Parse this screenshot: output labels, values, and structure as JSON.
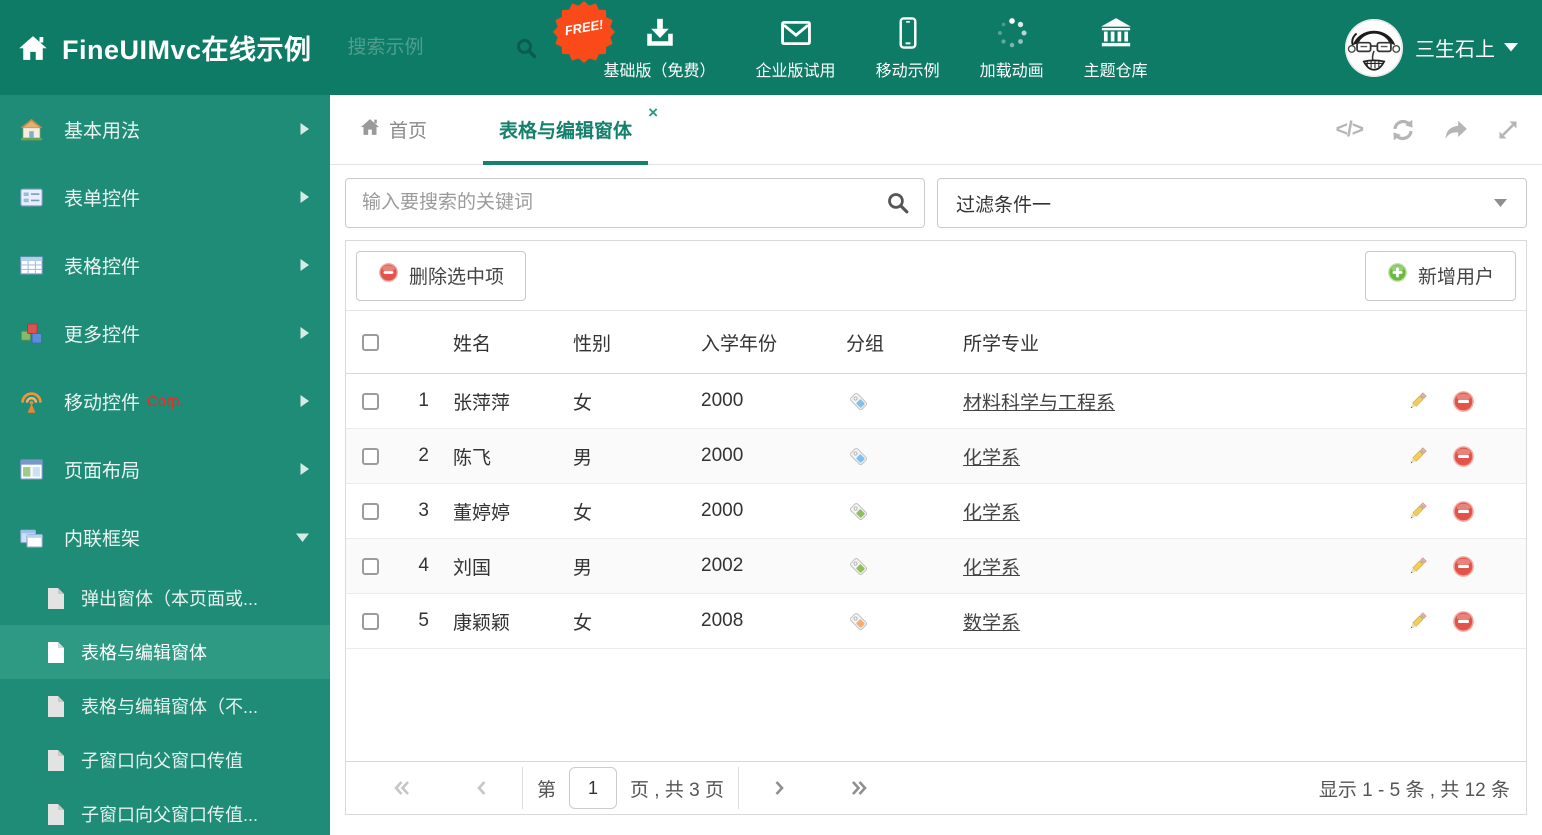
{
  "theme": {
    "header_bg": "#0e7b67",
    "sidebar_bg": "#1f8c77",
    "sidebar_active_bg": "#2f9a84",
    "accent_teal": "#15806b",
    "free_badge_bg": "#fb4a1a",
    "corp_badge_red": "#ff2222",
    "delete_red": "#e0544a",
    "add_green": "#6cb93f",
    "pencil_yellow": "#f2cd5e",
    "tag_blue": "#7ec1f0",
    "tag_green": "#8fbf5a",
    "tag_orange": "#f5ae6b"
  },
  "icons": {
    "code": "</>",
    "close": "×"
  },
  "header": {
    "title": "FineUIMvc在线示例",
    "search_placeholder": "搜索示例",
    "nav": [
      {
        "label": "基础版（免费）",
        "badge": "FREE!",
        "icon": "download-icon"
      },
      {
        "label": "企业版试用",
        "icon": "envelope-icon"
      },
      {
        "label": "移动示例",
        "icon": "mobile-icon"
      },
      {
        "label": "加载动画",
        "icon": "spinner-icon"
      },
      {
        "label": "主题仓库",
        "icon": "bank-icon"
      }
    ],
    "user_name": "三生石上"
  },
  "sidebar": {
    "items": [
      {
        "label": "基本用法",
        "icon": "house-icon"
      },
      {
        "label": "表单控件",
        "icon": "form-icon"
      },
      {
        "label": "表格控件",
        "icon": "table-icon"
      },
      {
        "label": "更多控件",
        "icon": "cubes-icon"
      },
      {
        "label": "移动控件",
        "badge": "Corp.",
        "icon": "antenna-icon"
      },
      {
        "label": "页面布局",
        "icon": "layout-icon"
      },
      {
        "label": "内联框架",
        "icon": "frames-icon",
        "expanded": true
      }
    ],
    "subitems": [
      {
        "label": "弹出窗体（本页面或..."
      },
      {
        "label": "表格与编辑窗体",
        "active": true
      },
      {
        "label": "表格与编辑窗体（不..."
      },
      {
        "label": "子窗口向父窗口传值"
      },
      {
        "label": "子窗口向父窗口传值..."
      }
    ]
  },
  "tabs": {
    "home": "首页",
    "active": "表格与编辑窗体"
  },
  "filterbar": {
    "search_placeholder": "输入要搜索的关键词",
    "filter_selected": "过滤条件一"
  },
  "toolbar": {
    "delete_label": "删除选中项",
    "add_label": "新增用户"
  },
  "table": {
    "columns": {
      "name": "姓名",
      "gender": "性别",
      "year": "入学年份",
      "group": "分组",
      "major": "所学专业"
    },
    "rows": [
      {
        "num": "1",
        "name": "张萍萍",
        "gender": "女",
        "year": "2000",
        "tag_color": "#7ec1f0",
        "major": "材料科学与工程系"
      },
      {
        "num": "2",
        "name": "陈飞",
        "gender": "男",
        "year": "2000",
        "tag_color": "#7ec1f0",
        "major": "化学系"
      },
      {
        "num": "3",
        "name": "董婷婷",
        "gender": "女",
        "year": "2000",
        "tag_color": "#8fbf5a",
        "major": "化学系"
      },
      {
        "num": "4",
        "name": "刘国",
        "gender": "男",
        "year": "2002",
        "tag_color": "#8fbf5a",
        "major": "化学系"
      },
      {
        "num": "5",
        "name": "康颖颖",
        "gender": "女",
        "year": "2008",
        "tag_color": "#f5ae6b",
        "major": "数学系"
      }
    ]
  },
  "pagination": {
    "prefix": "第",
    "page": "1",
    "suffix": "页 , 共 3 页",
    "summary": "显示 1 - 5 条 , 共 12 条"
  }
}
